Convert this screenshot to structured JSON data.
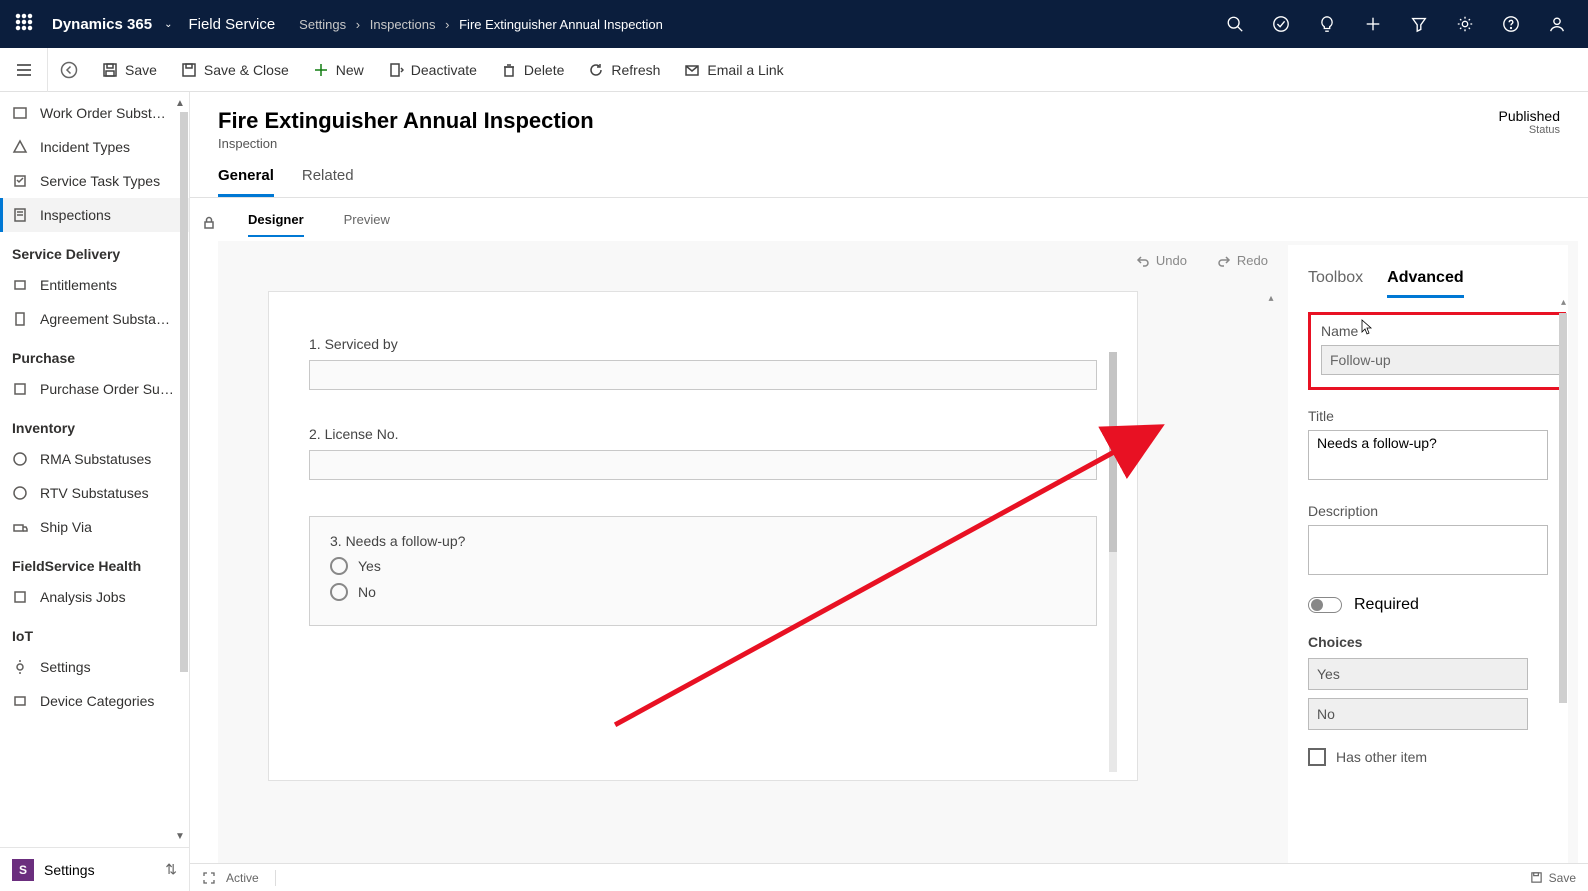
{
  "topbar": {
    "brand": "Dynamics 365",
    "module": "Field Service",
    "crumb1": "Settings",
    "crumb2": "Inspections",
    "crumb3": "Fire Extinguisher Annual Inspection"
  },
  "commands": {
    "save": "Save",
    "save_close": "Save & Close",
    "new": "New",
    "deactivate": "Deactivate",
    "delete": "Delete",
    "refresh": "Refresh",
    "email": "Email a Link"
  },
  "nav": {
    "items_top": [
      "Work Order Subst…",
      "Incident Types",
      "Service Task Types",
      "Inspections"
    ],
    "group1": "Service Delivery",
    "items_sd": [
      "Entitlements",
      "Agreement Substa…"
    ],
    "group2": "Purchase",
    "items_pu": [
      "Purchase Order Su…"
    ],
    "group3": "Inventory",
    "items_inv": [
      "RMA Substatuses",
      "RTV Substatuses",
      "Ship Via"
    ],
    "group4": "FieldService Health",
    "items_fs": [
      "Analysis Jobs"
    ],
    "group5": "IoT",
    "items_iot": [
      "Settings",
      "Device Categories"
    ],
    "footer_label": "Settings",
    "footer_badge": "S"
  },
  "page": {
    "title": "Fire Extinguisher Annual Inspection",
    "subtitle": "Inspection",
    "status_value": "Published",
    "status_label": "Status",
    "tab_general": "General",
    "tab_related": "Related",
    "tab_designer": "Designer",
    "tab_preview": "Preview",
    "undo": "Undo",
    "redo": "Redo"
  },
  "questions": {
    "q1": "1. Serviced by",
    "q2": "2. License No.",
    "q3": "3. Needs a follow-up?",
    "yes": "Yes",
    "no": "No"
  },
  "rightpanel": {
    "tab_toolbox": "Toolbox",
    "tab_advanced": "Advanced",
    "name_label": "Name",
    "name_value": "Follow-up",
    "title_label": "Title",
    "title_value": "Needs a follow-up?",
    "desc_label": "Description",
    "required_label": "Required",
    "choices_label": "Choices",
    "choice1": "Yes",
    "choice2": "No",
    "hasother": "Has other item"
  },
  "footer": {
    "active": "Active",
    "save": "Save"
  }
}
